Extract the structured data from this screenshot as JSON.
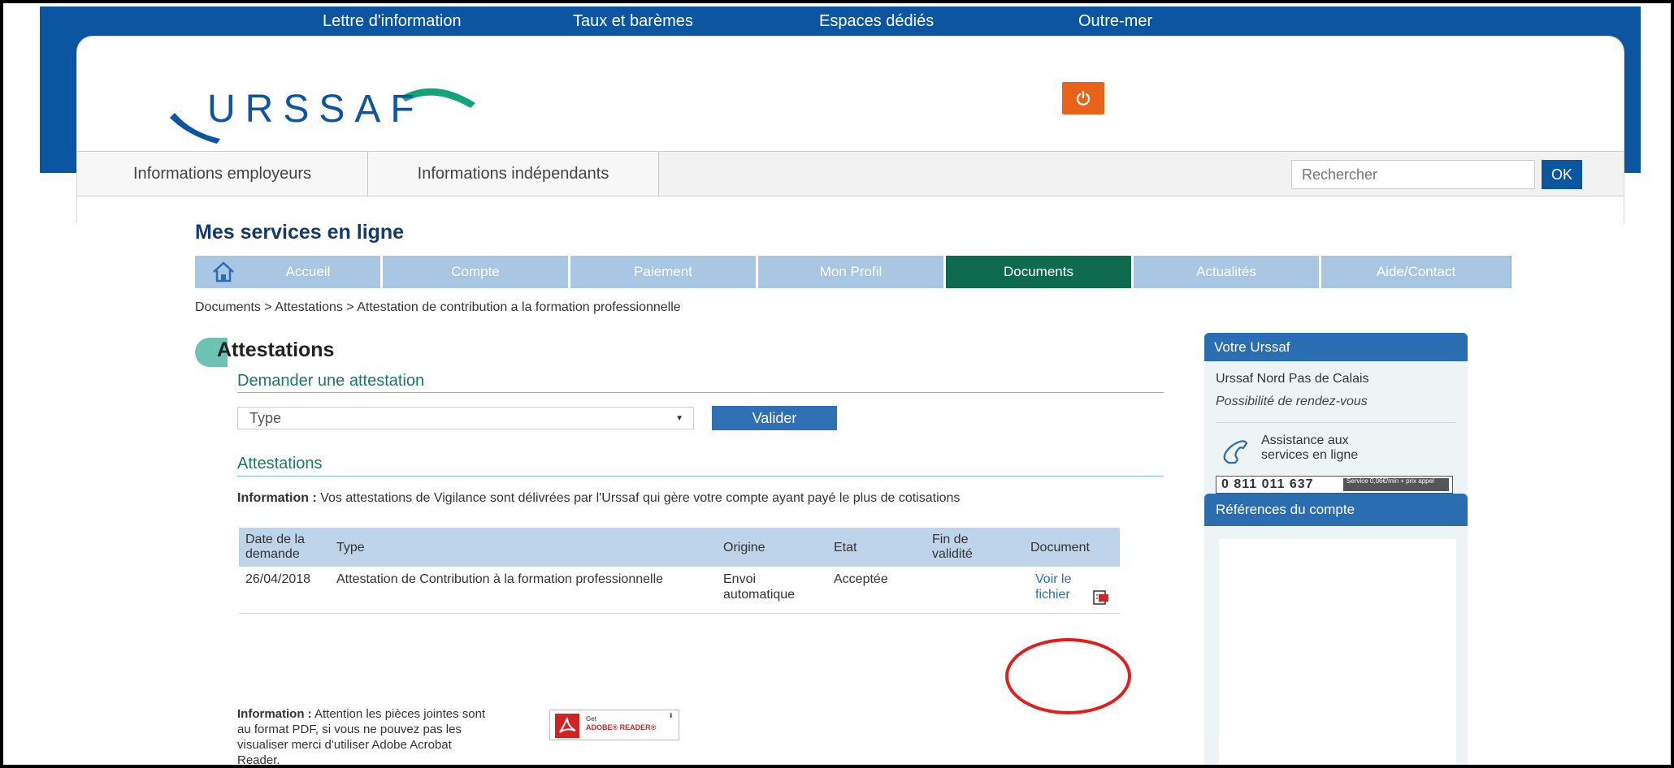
{
  "topnav": [
    "Lettre d'information",
    "Taux et barèmes",
    "Espaces dédiés",
    "Outre-mer"
  ],
  "logo": {
    "text": "URSSAF"
  },
  "mainnav": {
    "tabs": [
      "Informations employeurs",
      "Informations indépendants"
    ],
    "search_placeholder": "Rechercher",
    "search_button": "OK"
  },
  "services_title": "Mes services en ligne",
  "subnav": {
    "tabs": [
      "Accueil",
      "Compte",
      "Paiement",
      "Mon Profil",
      "Documents",
      "Actualités",
      "Aide/Contact"
    ],
    "active": "Documents"
  },
  "breadcrumb": "Documents > Attestations > Attestation de contribution a la formation professionnelle",
  "attestations": {
    "title": "Attestations",
    "request_title": "Demander une attestation",
    "type_select": "Type",
    "validate_button": "Valider",
    "list_title": "Attestations",
    "info_label": "Information :",
    "info_text": " Vos attestations de Vigilance sont délivrées par l'Urssaf qui gère votre compte ayant payé le plus de cotisations",
    "table": {
      "headers": [
        "Date de la demande",
        "Type",
        "Origine",
        "Etat",
        "Fin de validité",
        "Document"
      ],
      "rows": [
        {
          "date": "26/04/2018",
          "type": "Attestation de Contribution à la formation professionnelle",
          "origine": "Envoi automatique",
          "etat": "Acceptée",
          "fin": "",
          "document": "Voir le fichier"
        }
      ]
    },
    "info2_label": "Information :",
    "info2_text": " Attention les pièces jointes sont au format PDF, si vous ne pouvez pas les visualiser merci d'utiliser Adobe Acrobat Reader.",
    "adobe_badge": {
      "line1": "Get",
      "line2": "ADOBE® READER®"
    }
  },
  "sidebar": {
    "votre_urssaf": {
      "title": "Votre Urssaf",
      "name": "Urssaf Nord Pas de Calais",
      "rdv": "Possibilité de rendez-vous",
      "assistance": "Assistance aux services en ligne",
      "phone": "0 811 011 637",
      "price": "Service 0,06€/min + prix appel"
    },
    "references": {
      "title": "Références du compte"
    }
  },
  "colors": {
    "brand_blue": "#0c55a1",
    "active_tab": "#0f6b4e",
    "subnav_tab": "#a9c6e3",
    "power_button": "#e8621a",
    "highlight": "#e21d1d"
  }
}
